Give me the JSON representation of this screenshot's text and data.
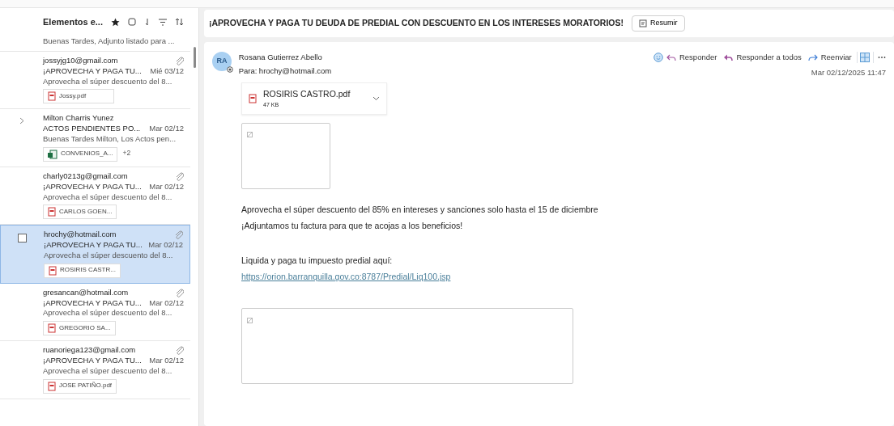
{
  "list_header": {
    "title": "Elementos e..."
  },
  "partial_preview": "Buenas Tardes, Adjunto listado para ...",
  "messages": [
    {
      "sender": "jossyjg10@gmail.com",
      "subject": "¡APROVECHA Y PAGA TU...",
      "date": "Mié 03/12",
      "preview": "Aprovecha el súper descuento del 8...",
      "has_attachment": true,
      "thread": false,
      "selected": false,
      "attachments": [
        {
          "name": "Jossy.pdf",
          "kind": "pdf"
        }
      ]
    },
    {
      "sender": "Milton Charris Yunez",
      "subject": "ACTOS PENDIENTES PO...",
      "date": "Mar 02/12",
      "preview": "Buenas Tardes Milton, Los Actos pen...",
      "has_attachment": false,
      "thread": true,
      "selected": false,
      "attachments": [
        {
          "name": "CONVENIOS_A...",
          "kind": "excel"
        }
      ],
      "more": "+2"
    },
    {
      "sender": "charly0213g@gmail.com",
      "subject": "¡APROVECHA Y PAGA TU...",
      "date": "Mar 02/12",
      "preview": "Aprovecha el súper descuento del 8...",
      "has_attachment": true,
      "thread": false,
      "selected": false,
      "attachments": [
        {
          "name": "CARLOS GOEN...",
          "kind": "pdf"
        }
      ]
    },
    {
      "sender": "hrochy@hotmail.com",
      "subject": "¡APROVECHA Y PAGA TU...",
      "date": "Mar 02/12",
      "preview": "Aprovecha el súper descuento del 8...",
      "has_attachment": true,
      "thread": false,
      "selected": true,
      "attachments": [
        {
          "name": "ROSIRIS CASTR...",
          "kind": "pdf"
        }
      ]
    },
    {
      "sender": "gresancan@hotmail.com",
      "subject": "¡APROVECHA Y PAGA TU...",
      "date": "Mar 02/12",
      "preview": "Aprovecha el súper descuento del 8...",
      "has_attachment": true,
      "thread": false,
      "selected": false,
      "attachments": [
        {
          "name": "GREGORIO SA...",
          "kind": "pdf"
        }
      ]
    },
    {
      "sender": "ruanoriega123@gmail.com",
      "subject": "¡APROVECHA Y PAGA TU...",
      "date": "Mar 02/12",
      "preview": "Aprovecha el súper descuento del 8...",
      "has_attachment": true,
      "thread": false,
      "selected": false,
      "attachments": [
        {
          "name": "JOSE PATIÑO.pdf",
          "kind": "pdf"
        }
      ]
    }
  ],
  "reading": {
    "subject": "¡APROVECHA Y PAGA TU DEUDA DE PREDIAL CON DESCUENTO EN LOS INTERESES MORATORIOS!",
    "summarize": "Resumir",
    "avatar": "RA",
    "sender": "Rosana Gutierrez Abello",
    "to_label": "Para:",
    "to": "hrochy@hotmail.com",
    "actions": [
      {
        "label": "Responder",
        "kind": "reply"
      },
      {
        "label": "Responder a todos",
        "kind": "reply-all"
      },
      {
        "label": "Reenviar",
        "kind": "forward"
      }
    ],
    "date": "Mar 02/12/2025 11:47",
    "attachment": {
      "name": "ROSIRIS CASTRO.pdf",
      "size": "47 KB"
    },
    "body": [
      {
        "kind": "thumbnail"
      },
      {
        "kind": "text",
        "text": "Aprovecha el súper descuento del 85% en intereses y sanciones solo hasta el 15 de diciembre"
      },
      {
        "kind": "text",
        "text": "¡Adjuntamos tu factura para que te acojas a los beneficios!"
      },
      {
        "kind": "spacer"
      },
      {
        "kind": "text",
        "text": "Liquida y paga tu impuesto predial aquí:"
      },
      {
        "kind": "link",
        "text": "https://orion.barranquilla.gov.co:8787/Predial/Liq100.jsp"
      },
      {
        "kind": "spacer"
      },
      {
        "kind": "banner"
      }
    ]
  }
}
